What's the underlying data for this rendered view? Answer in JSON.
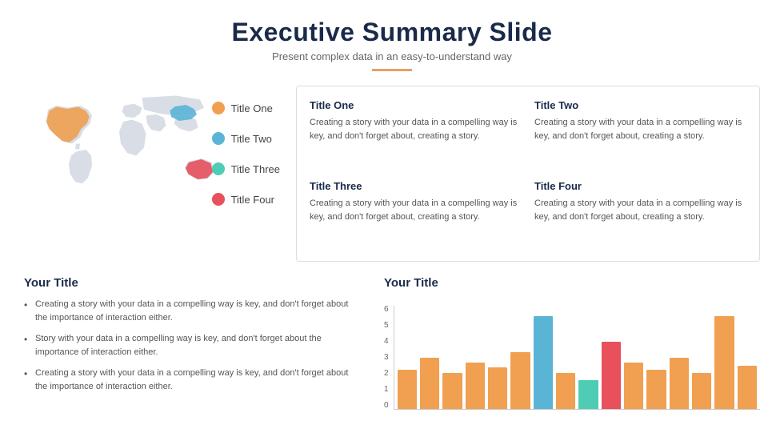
{
  "header": {
    "title": "Executive Summary Slide",
    "subtitle": "Present complex data in an easy-to-understand way"
  },
  "legend": {
    "items": [
      {
        "label": "Title One",
        "color": "#f0a050"
      },
      {
        "label": "Title Two",
        "color": "#5ab4d6"
      },
      {
        "label": "Title Three",
        "color": "#4ecdb4"
      },
      {
        "label": "Title Four",
        "color": "#e8505b"
      }
    ]
  },
  "info_cards": [
    {
      "title": "Title One",
      "text": "Creating a story with your data in a compelling way is key, and don't forget about, creating a story."
    },
    {
      "title": "Title Two",
      "text": "Creating a story with your data in a compelling way is key, and don't forget about, creating a story."
    },
    {
      "title": "Title Three",
      "text": "Creating a story with your data in a compelling way is key, and don't forget about, creating a story."
    },
    {
      "title": "Title Four",
      "text": "Creating a story with your data in a compelling way is key, and don't forget about, creating a story."
    }
  ],
  "bullet_section": {
    "title": "Your Title",
    "items": [
      "Creating a story with your data in a compelling way is key, and don't forget about the importance of interaction either.",
      "Story with your data in a compelling way is key, and don't forget about the importance of interaction either.",
      "Creating a story with your data in a compelling way is key, and don't forget about the importance of interaction either."
    ]
  },
  "chart_section": {
    "title": "Your Title",
    "y_labels": [
      "0",
      "1",
      "2",
      "3",
      "4",
      "5",
      "6"
    ],
    "bars": [
      {
        "height_pct": 38,
        "color": "#f0a050"
      },
      {
        "height_pct": 50,
        "color": "#f0a050"
      },
      {
        "height_pct": 35,
        "color": "#f0a050"
      },
      {
        "height_pct": 45,
        "color": "#f0a050"
      },
      {
        "height_pct": 40,
        "color": "#f0a050"
      },
      {
        "height_pct": 55,
        "color": "#f0a050"
      },
      {
        "height_pct": 90,
        "color": "#5ab4d6"
      },
      {
        "height_pct": 35,
        "color": "#f0a050"
      },
      {
        "height_pct": 28,
        "color": "#4ecdb4"
      },
      {
        "height_pct": 65,
        "color": "#e8505b"
      },
      {
        "height_pct": 45,
        "color": "#f0a050"
      },
      {
        "height_pct": 38,
        "color": "#f0a050"
      },
      {
        "height_pct": 50,
        "color": "#f0a050"
      },
      {
        "height_pct": 35,
        "color": "#f0a050"
      },
      {
        "height_pct": 90,
        "color": "#f0a050"
      },
      {
        "height_pct": 42,
        "color": "#f0a050"
      }
    ]
  },
  "colors": {
    "title_one": "#f0a050",
    "title_two": "#5ab4d6",
    "title_three": "#4ecdb4",
    "title_four": "#e8505b",
    "map_usa": "#f0a050",
    "map_china": "#5ab4d6",
    "map_australia": "#e8505b",
    "map_base": "#d8dde6"
  }
}
